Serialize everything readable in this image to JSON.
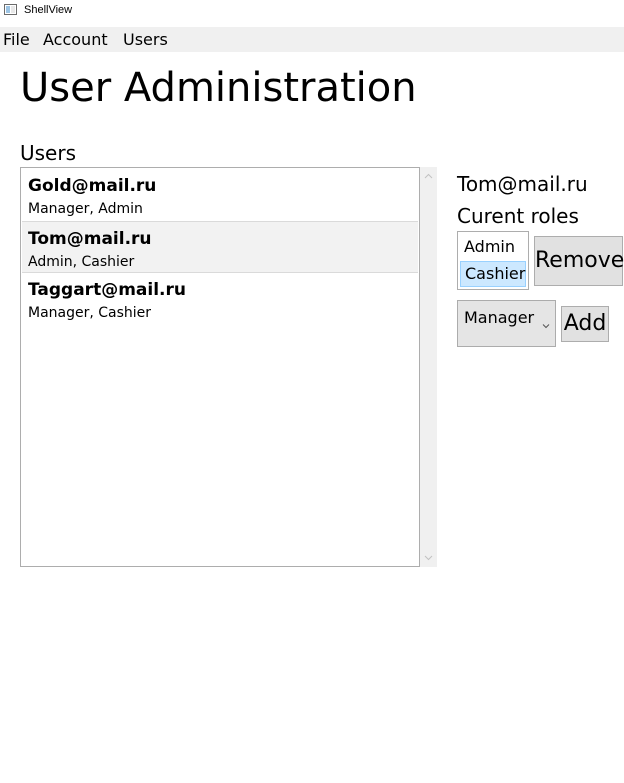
{
  "window": {
    "title": "ShellView"
  },
  "menu": {
    "items": [
      "File",
      "Account",
      "Users"
    ]
  },
  "page": {
    "title": "User Administration",
    "users_label": "Users"
  },
  "users": [
    {
      "email": "Gold@mail.ru",
      "roles": "Manager, Admin",
      "selected": false
    },
    {
      "email": "Tom@mail.ru",
      "roles": "Admin, Cashier",
      "selected": true
    },
    {
      "email": "Taggart@mail.ru",
      "roles": "Manager, Cashier",
      "selected": false
    }
  ],
  "details": {
    "selected_email": "Tom@mail.ru",
    "roles_label": "Curent roles",
    "current_roles": [
      "Admin",
      "Cashier"
    ],
    "selected_role": "Cashier",
    "remove_label": "Remove",
    "role_dropdown_value": "Manager",
    "add_label": "Add"
  },
  "colors": {
    "selection_highlight": "#cce8ff",
    "button_face": "#e1e1e1",
    "menubar_bg": "#f0f0f0"
  }
}
